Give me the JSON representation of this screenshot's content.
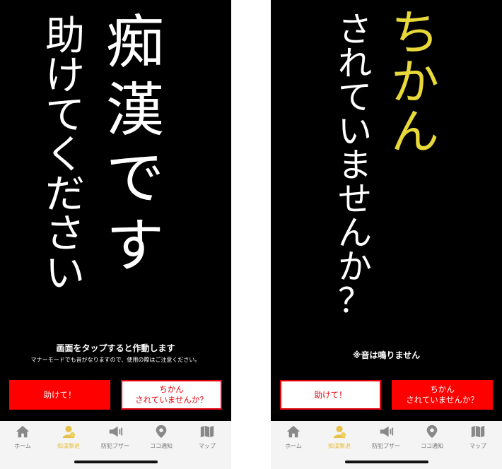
{
  "left": {
    "main_chars": [
      "痴",
      "漢",
      "で",
      "す"
    ],
    "sub_chars": [
      "助",
      "け",
      "て",
      "く",
      "だ",
      "さ",
      "い"
    ],
    "caption_main": "画面をタップすると作動します",
    "caption_sub": "マナーモードでも音がなりますので、使用の際はご注意ください。",
    "btn_help": "助けて！",
    "btn_ask_line1": "ちかん",
    "btn_ask_line2": "されていませんか？"
  },
  "right": {
    "yellow_chars": [
      "ち",
      "か",
      "ん"
    ],
    "white_chars": [
      "さ",
      "れ",
      "て",
      "い",
      "ま",
      "せ",
      "ん",
      "か",
      "？"
    ],
    "note": "※音は鳴りません",
    "btn_help": "助けて！",
    "btn_ask_line1": "ちかん",
    "btn_ask_line2": "されていませんか？"
  },
  "tabs": [
    {
      "label": "ホーム",
      "icon": "home-icon"
    },
    {
      "label": "痴漢撃退",
      "icon": "alert-person-icon"
    },
    {
      "label": "防犯ブザー",
      "icon": "megaphone-icon"
    },
    {
      "label": "ココ通知",
      "icon": "location-pin-icon"
    },
    {
      "label": "マップ",
      "icon": "map-icon"
    }
  ],
  "colors": {
    "accent_red": "#ff0000",
    "active_tab": "#e6c24a",
    "yellow_text": "#e8d83a"
  }
}
